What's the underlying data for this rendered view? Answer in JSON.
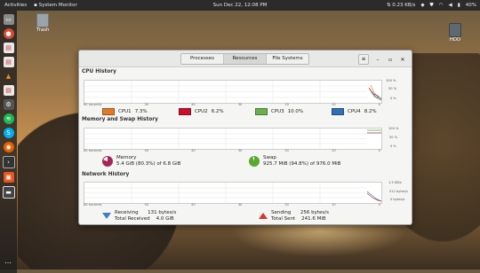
{
  "topbar": {
    "activities": "Activities",
    "app_name": "System Monitor",
    "clock": "Sun Dec 22, 12:08 PM",
    "net_speed": "⇅ 0.23 KB/s",
    "battery": "40%"
  },
  "desktop": {
    "trash_label": "Trash",
    "hdd_label": "HDD"
  },
  "window": {
    "tabs": [
      {
        "label": "Processes"
      },
      {
        "label": "Resources"
      },
      {
        "label": "File Systems"
      }
    ],
    "active_tab": "Resources"
  },
  "cpu": {
    "title": "CPU History",
    "pct_labels": [
      "100 %",
      "50 %",
      "0 %"
    ],
    "x_labels": [
      "60 seconds",
      "50",
      "40",
      "30",
      "20",
      "10",
      "0"
    ],
    "cores": [
      {
        "label": "CPU1",
        "value": "7.3%",
        "color": "#e07b2a"
      },
      {
        "label": "CPU2",
        "value": "6.2%",
        "color": "#c8102e"
      },
      {
        "label": "CPU3",
        "value": "10.0%",
        "color": "#6ab04c"
      },
      {
        "label": "CPU4",
        "value": "8.2%",
        "color": "#2f6fb6"
      }
    ]
  },
  "memory": {
    "title": "Memory and Swap History",
    "pct_labels": [
      "100 %",
      "50 %",
      "0 %"
    ],
    "x_labels": [
      "60 seconds",
      "50",
      "40",
      "30",
      "20",
      "10",
      "0"
    ],
    "memory_label": "Memory",
    "memory_value": "5.4 GiB (80.3%) of 6.8 GiB",
    "memory_fraction": 0.803,
    "memory_color": "#a3285a",
    "swap_label": "Swap",
    "swap_value": "925.7 MiB (94.8%) of 976.0 MiB",
    "swap_fraction": 0.948,
    "swap_color": "#5aa832"
  },
  "network": {
    "title": "Network History",
    "rate_labels": [
      "1.3 KB/s",
      "512 bytes/s",
      "0 bytes/s"
    ],
    "x_labels": [
      "60 seconds",
      "50",
      "40",
      "30",
      "20",
      "10",
      "0"
    ],
    "receiving_label": "Receiving",
    "receiving_value": "131 bytes/s",
    "total_received_label": "Total Received",
    "total_received_value": "4.0 GiB",
    "sending_label": "Sending",
    "sending_value": "256 bytes/s",
    "total_sent_label": "Total Sent",
    "total_sent_value": "241.6 MiB"
  },
  "icons": {
    "dock": [
      "files-icon",
      "chrome-icon",
      "document-icon",
      "document-icon",
      "vlc-icon",
      "document-icon",
      "settings-icon",
      "spotify-icon",
      "skype-icon",
      "firefox-icon",
      "terminal-icon",
      "software-icon",
      "monitor-icon"
    ]
  }
}
